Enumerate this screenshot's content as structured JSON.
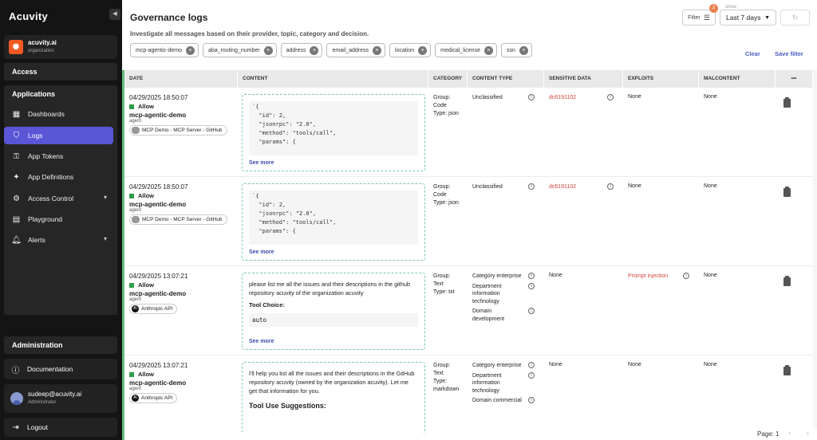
{
  "sidebar": {
    "brand": "Acuvity",
    "org": {
      "name": "acuvity.ai",
      "sub": "organization"
    },
    "access": "Access",
    "applications": "Applications",
    "items": [
      {
        "label": "Dashboards",
        "icon": "dashboard-icon"
      },
      {
        "label": "Logs",
        "icon": "shield-icon",
        "active": true
      },
      {
        "label": "App Tokens",
        "icon": "key-icon"
      },
      {
        "label": "App Definitions",
        "icon": "puzzle-icon"
      },
      {
        "label": "Access Control",
        "icon": "gear-icon"
      },
      {
        "label": "Playground",
        "icon": "chat-icon"
      },
      {
        "label": "Alerts",
        "icon": "bell-icon"
      }
    ],
    "administration": "Administration",
    "documentation": "Documentation",
    "user": {
      "email": "sudeep@acuvity.ai",
      "role": "Administrator"
    },
    "logout": "Logout"
  },
  "header": {
    "title": "Governance logs",
    "subtitle": "Investigate all messages based on their provider, topic, category and decision.",
    "filter_label": "Filter",
    "filter_count": "2",
    "since_label": "since",
    "since_value": "Last 7 days",
    "clear": "Clear",
    "save_filter": "Save filter"
  },
  "chips": [
    "mcp-agentic-demo",
    "aba_routing_number",
    "address",
    "email_address",
    "location",
    "medical_license",
    "ssn"
  ],
  "columns": [
    "DATE",
    "CONTENT",
    "CATEGORY",
    "CONTENT TYPE",
    "SENSITIVE DATA",
    "EXPLOITS",
    "MALCONTENT",
    "•••"
  ],
  "rows": [
    {
      "date": "04/29/2025 18:50:07",
      "decision": "Allow",
      "agent": "mcp-agentic-demo",
      "agent_type": "agent",
      "source": "MCP Demo - MCP Server - GitHub",
      "code": "`{\n  \"id\": 2,\n  \"jsonrpc\": \"2.0\",\n  \"method\": \"tools/call\",\n  \"params\": {",
      "see_more": "See more",
      "category": [
        "Group:",
        "Code",
        "Type: json"
      ],
      "content_type": "Unclassified",
      "sensitive": "dc6191102",
      "exploits": "None",
      "malcontent": "None"
    },
    {
      "date": "04/29/2025 18:50:07",
      "decision": "Allow",
      "agent": "mcp-agentic-demo",
      "agent_type": "agent",
      "source": "MCP Demo - MCP Server - GitHub",
      "code": "`{\n  \"id\": 2,\n  \"jsonrpc\": \"2.0\",\n  \"method\": \"tools/call\",\n  \"params\": {",
      "see_more": "See more",
      "category": [
        "Group:",
        "Code",
        "Type: json"
      ],
      "content_type": "Unclassified",
      "sensitive": "dc6191102",
      "exploits": "None",
      "malcontent": "None"
    },
    {
      "date": "04/29/2025 13:07:21",
      "decision": "Allow",
      "agent": "mcp-agentic-demo",
      "agent_type": "agent",
      "source": "Anthropic API",
      "text": "please list me all the issues and their descriptions in the github repository acuvity of the organization acuvity",
      "tool_title": "Tool Choice:",
      "tool_value": "auto",
      "see_more": "See more",
      "category": [
        "Group:",
        "Text",
        "Type: txt"
      ],
      "content_types": [
        "Category enterprise",
        "Department information technology",
        "Domain development"
      ],
      "sensitive": "None",
      "exploits": "Prompt injection",
      "malcontent": "None"
    },
    {
      "date": "04/29/2025 13:07:21",
      "decision": "Allow",
      "agent": "mcp-agentic-demo",
      "agent_type": "agent",
      "source": "Anthropic API",
      "text": "I'll help you list all the issues and their descriptions in the GitHub repository acuvity (owned by the organization acuvity). Let me get that information for you.",
      "tool_title": "Tool Use Suggestions:",
      "category": [
        "Group:",
        "Text",
        "Type:",
        "markdown"
      ],
      "content_types": [
        "Category enterprise",
        "Department information technology",
        "Domain commercial"
      ],
      "sensitive": "None",
      "exploits": "None",
      "malcontent": "None"
    }
  ],
  "footer": {
    "page": "Page: 1"
  }
}
